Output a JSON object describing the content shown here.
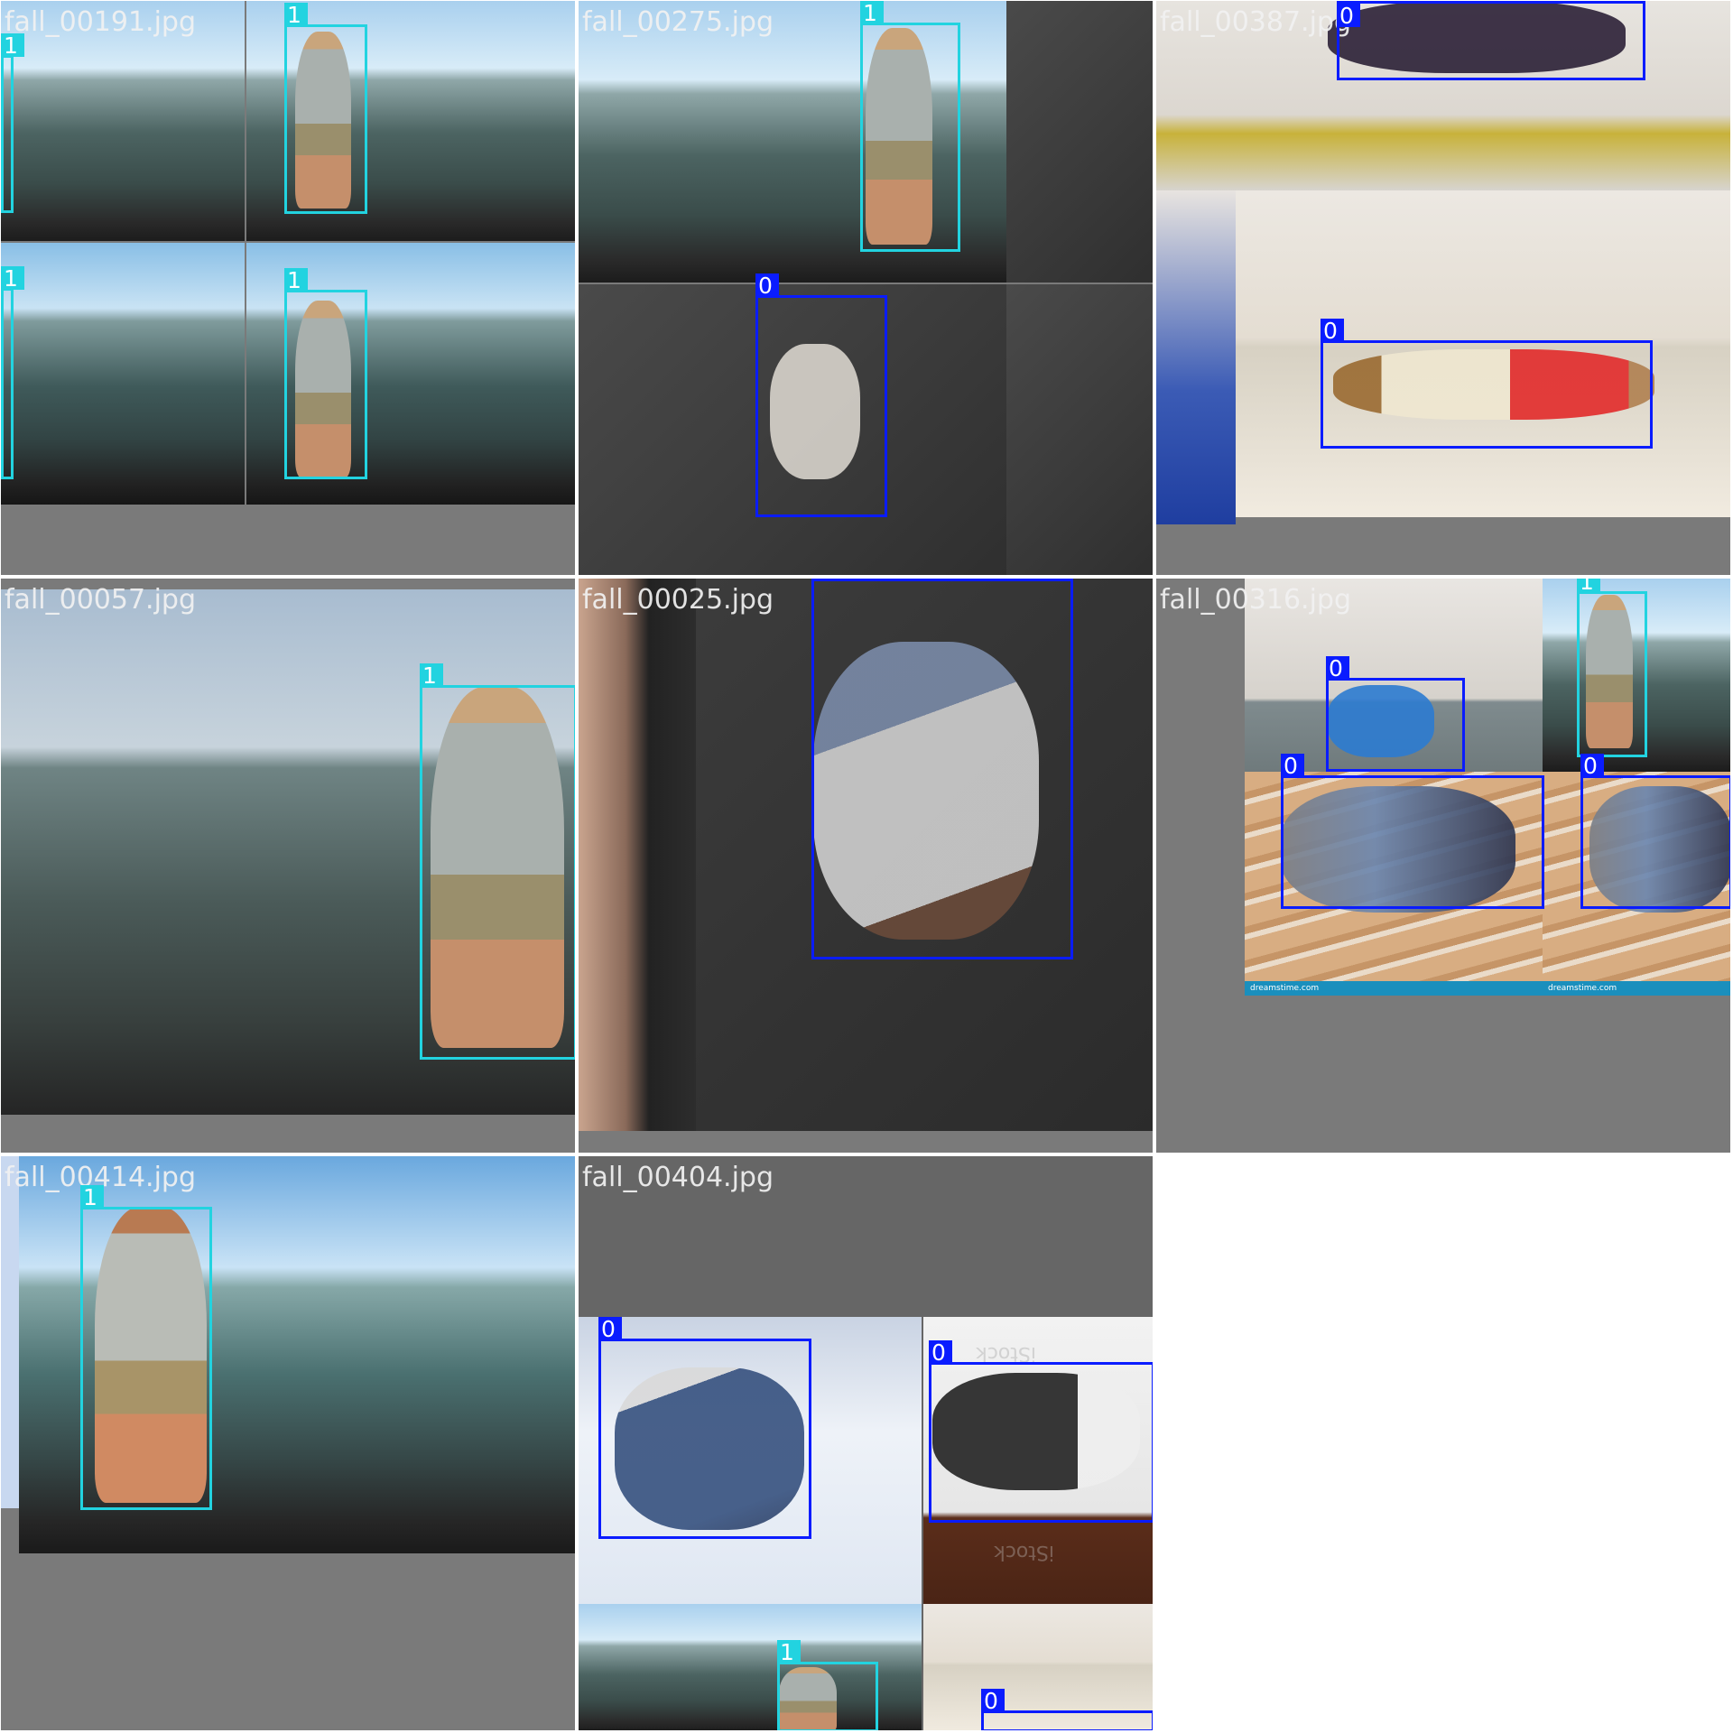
{
  "page": {
    "background": "#ffffff",
    "tile_padding_color": "#7a7a7a"
  },
  "classes": {
    "0": {
      "label": "0",
      "color": "#0a1cff"
    },
    "1": {
      "label": "1",
      "color": "#22d3e0"
    }
  },
  "tiles": [
    {
      "filename": "fall_00191.jpg",
      "labels": [
        "1",
        "1",
        "1",
        "1"
      ]
    },
    {
      "filename": "fall_00275.jpg",
      "labels": [
        "1",
        "0"
      ]
    },
    {
      "filename": "fall_00387.jpg",
      "labels": [
        "0",
        "0"
      ]
    },
    {
      "filename": "fall_00057.jpg",
      "labels": [
        "1"
      ]
    },
    {
      "filename": "fall_00025.jpg",
      "labels": [
        "0"
      ]
    },
    {
      "filename": "fall_00316.jpg",
      "labels": [
        "1",
        "0",
        "0",
        "0"
      ],
      "watermarks": [
        "dreamstime.com",
        "dreamstime.com"
      ]
    },
    {
      "filename": "fall_00414.jpg",
      "labels": [
        "1"
      ]
    },
    {
      "filename": "fall_00404.jpg",
      "labels": [
        "0",
        "0",
        "1",
        "0"
      ],
      "watermarks": [
        "iStock",
        "iStock"
      ]
    }
  ]
}
